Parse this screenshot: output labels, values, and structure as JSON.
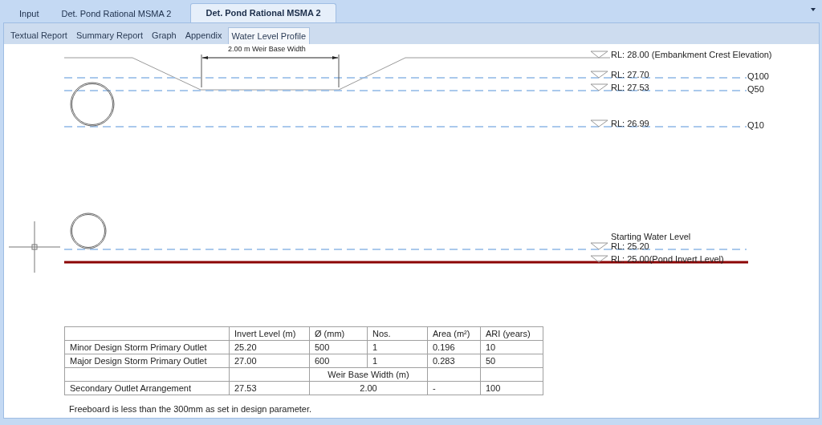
{
  "tabs": [
    {
      "label": "Input",
      "selected": false
    },
    {
      "label": "Det. Pond Rational MSMA 2",
      "selected": false
    },
    {
      "label": "Det. Pond Rational MSMA 2",
      "selected": true
    }
  ],
  "subtabs": [
    {
      "label": "Textual Report",
      "selected": false
    },
    {
      "label": "Summary Report",
      "selected": false
    },
    {
      "label": "Graph",
      "selected": false
    },
    {
      "label": "Appendix",
      "selected": false
    },
    {
      "label": "Water Level Profile",
      "selected": true
    }
  ],
  "profile": {
    "weir_dimension": "2.00 m Weir Base Width",
    "levels": [
      {
        "kind": "crest",
        "rl": "RL: 28.00 (Embankment Crest Elevation)"
      },
      {
        "kind": "water",
        "rl": "RL: 27.70",
        "storm": "Q100"
      },
      {
        "kind": "water",
        "rl": "RL: 27.53",
        "storm": "Q50"
      },
      {
        "kind": "water",
        "rl": "RL: 26.99",
        "storm": "Q10"
      },
      {
        "kind": "water",
        "caption": "Starting Water Level",
        "rl": "RL: 25.20"
      },
      {
        "kind": "invert",
        "rl": "RL: 25.00(Pond Invert Level)"
      }
    ]
  },
  "table": {
    "columns": [
      "Invert Level (m)",
      "Ø (mm)",
      "Nos.",
      "Area (m²)",
      "ARI (years)"
    ],
    "rows": [
      {
        "kind": "data",
        "cells": [
          "Minor Design Storm Primary Outlet",
          "25.20",
          "500",
          "1",
          "0.196",
          "10"
        ]
      },
      {
        "kind": "data",
        "cells": [
          "Major Design Storm Primary Outlet",
          "27.00",
          "600",
          "1",
          "0.283",
          "50"
        ]
      },
      {
        "kind": "subheader",
        "text": "Weir Base Width (m)"
      },
      {
        "kind": "weir",
        "cells": [
          "Secondary Outlet Arrangement",
          "27.53",
          "2.00",
          "-",
          "100"
        ]
      }
    ]
  },
  "note": "Freeboard is less than the 300mm as set in design parameter."
}
